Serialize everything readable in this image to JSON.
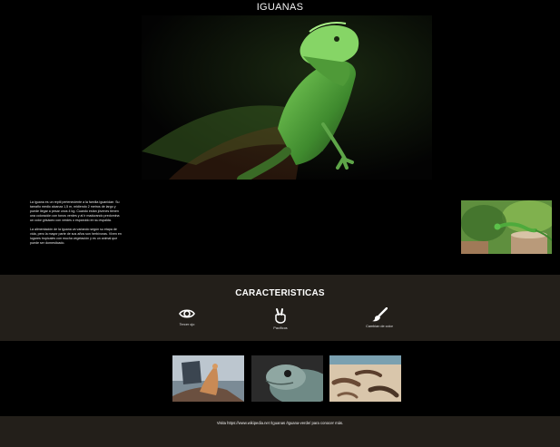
{
  "page": {
    "title": "IGUANAS"
  },
  "hero": {
    "image_name": "green-iguana-dark-photo"
  },
  "intro": {
    "paragraphs": [
      "La iguana es un reptil perteneciente a la familia Iguanidae. Su tamaño medio alcanza 1,5 m, midiendo 2 metros de largo y puede llegar a pesar unos 4 kg. Cuando están jóvenes tienen una coloración con tonos verdes y al ir madurando predomina un color grisáceo con verdes o esparcido en su espalda.",
      "La alimentación de la iguana va variando según su etapa de vida, pero la mayor parte de sus años son herbívoras. Viven en lugares tropicales con mucha vegetación y es un animal que puede ser domesticado."
    ],
    "photo_name": "iguana-on-stump-photo"
  },
  "features": {
    "title": "CARACTERISTICAS",
    "items": [
      {
        "label": "Tercer ojo",
        "icon": "eye-icon"
      },
      {
        "label": "Pacíficos",
        "icon": "peace-hand-icon"
      },
      {
        "label": "Cambian de color",
        "icon": "paintbrush-icon"
      }
    ]
  },
  "gallery": {
    "items": [
      {
        "name": "iguana-on-rock-photo"
      },
      {
        "name": "iguana-head-photo"
      },
      {
        "name": "iguanas-on-sand-photo"
      }
    ]
  },
  "footer": {
    "text": "Visita https://www.wikipedia.net /Iguanas /Iguana-verde/ para conocer más."
  },
  "colors": {
    "background": "#000000",
    "section_band": "#231f1a",
    "iguana_green": "#5fb04a"
  }
}
